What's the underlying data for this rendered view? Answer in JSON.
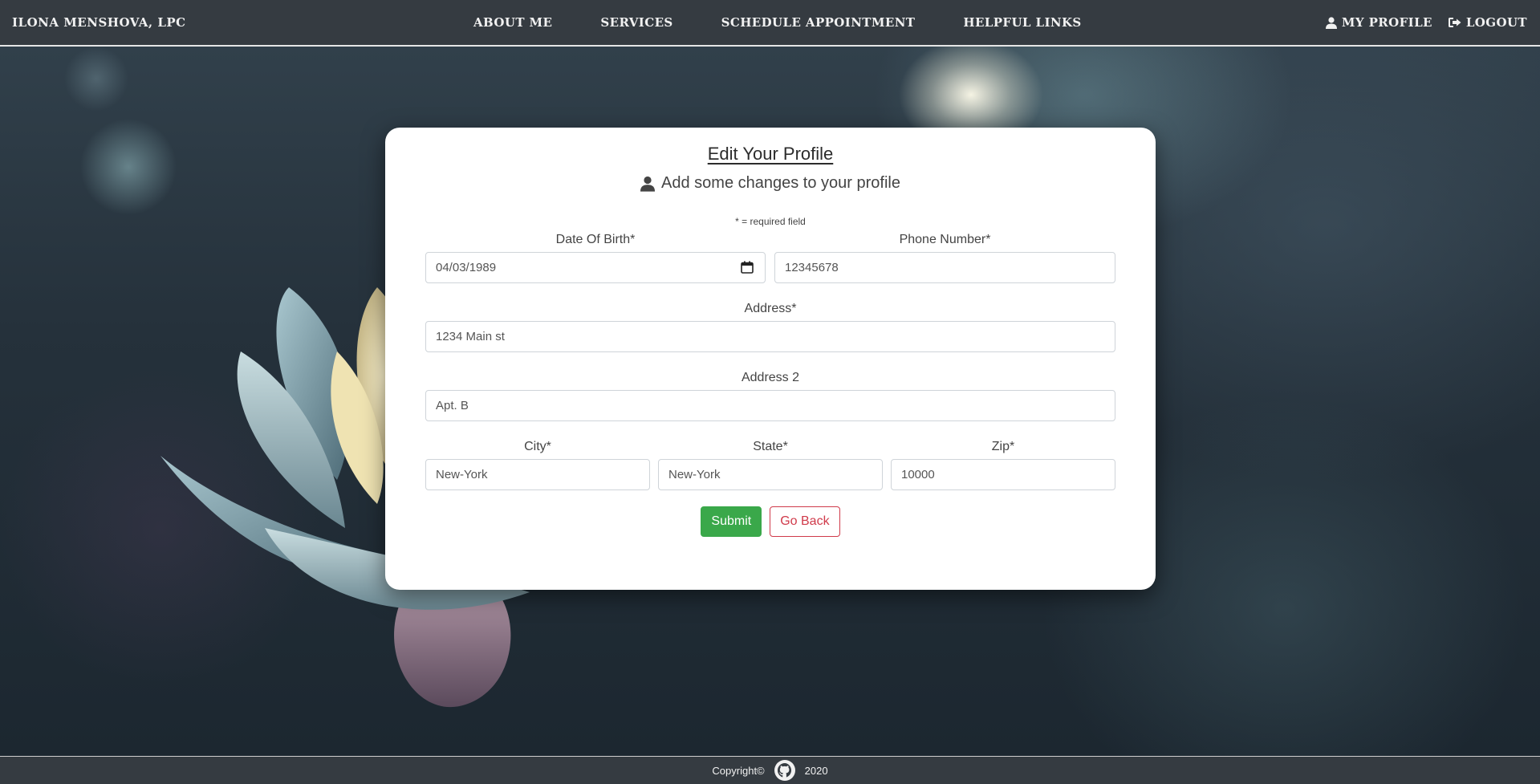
{
  "navbar": {
    "brand": "ILONA MENSHOVA, LPC",
    "links": [
      {
        "label": "ABOUT ME"
      },
      {
        "label": "SERVICES"
      },
      {
        "label": "SCHEDULE APPOINTMENT"
      },
      {
        "label": "HELPFUL LINKS"
      }
    ],
    "my_profile": "MY PROFILE",
    "logout": "LOGOUT"
  },
  "form": {
    "title": "Edit Your Profile",
    "subtitle": "Add some changes to your profile",
    "required_note": "* = required field",
    "dob": {
      "label": "Date Of Birth*",
      "value": "04/03/1989"
    },
    "phone": {
      "label": "Phone Number*",
      "value": "12345678"
    },
    "address": {
      "label": "Address*",
      "value": "1234 Main st"
    },
    "address2": {
      "label": "Address 2",
      "value": "Apt. B"
    },
    "city": {
      "label": "City*",
      "value": "New-York"
    },
    "state": {
      "label": "State*",
      "value": "New-York"
    },
    "zip": {
      "label": "Zip*",
      "value": "10000"
    },
    "submit_label": "Submit",
    "back_label": "Go Back"
  },
  "footer": {
    "copyright": "Copyright©",
    "year": "2020"
  },
  "colors": {
    "navbar": "#353b41",
    "submit": "#3aa84a",
    "back": "#d03a4a"
  }
}
